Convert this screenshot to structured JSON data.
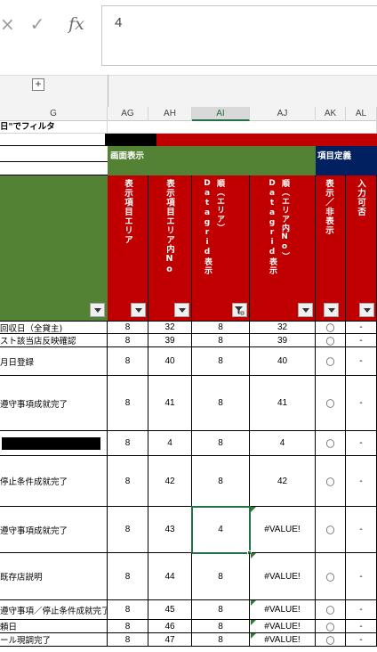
{
  "formula_bar": {
    "cancel_icon": "×",
    "enter_icon": "✓",
    "fx_icon": "fx",
    "value": "4"
  },
  "group_strip": {
    "expand_icon": "+"
  },
  "columns": [
    {
      "key": "G",
      "label": "G"
    },
    {
      "key": "AG",
      "label": "AG"
    },
    {
      "key": "AH",
      "label": "AH"
    },
    {
      "key": "AI",
      "label": "AI",
      "selected": true
    },
    {
      "key": "AJ",
      "label": "AJ"
    },
    {
      "key": "AK",
      "label": "AK"
    },
    {
      "key": "AL",
      "label": "AL"
    }
  ],
  "top_label": "日\"でフィルタ",
  "section_display": "画面表示",
  "section_item_def": "項目定義",
  "headers": {
    "ag": "表示項目エリア",
    "ah": "表示項目エリア内No",
    "ai": "順（エリア）Datagrid表示",
    "aj": "順（エリア内No）Datagrid表示",
    "ak": "表示／非表示",
    "al": "入力可否"
  },
  "rows": [
    {
      "label": "回収日（全貸主)",
      "ag": "8",
      "ah": "32",
      "ai": "8",
      "aj": "32",
      "ak": "〇",
      "al": "-"
    },
    {
      "label": "スト該当店反映確認",
      "ag": "8",
      "ah": "39",
      "ai": "8",
      "aj": "39",
      "ak": "〇",
      "al": "-"
    },
    {
      "label": "月日登録",
      "ag": "8",
      "ah": "40",
      "ai": "8",
      "aj": "40",
      "ak": "〇",
      "al": "-"
    },
    {
      "label": "遵守事項成就完了",
      "ag": "8",
      "ah": "41",
      "ai": "8",
      "aj": "41",
      "ak": "〇",
      "al": "-"
    },
    {
      "label": "",
      "ag": "8",
      "ah": "4",
      "ai": "8",
      "aj": "4",
      "ak": "〇",
      "al": "-",
      "redacted": true
    },
    {
      "label": "停止条件成就完了",
      "ag": "8",
      "ah": "42",
      "ai": "8",
      "aj": "42",
      "ak": "〇",
      "al": "-"
    },
    {
      "label": "遵守事項成就完了",
      "ag": "8",
      "ah": "43",
      "ai": "4",
      "aj": "#VALUE!",
      "ak": "〇",
      "al": "-",
      "active": true
    },
    {
      "label": "既存店説明",
      "ag": "8",
      "ah": "44",
      "ai": "8",
      "aj": "#VALUE!",
      "ak": "〇",
      "al": "-"
    },
    {
      "label": "遵守事項／停止条件成就完了",
      "ag": "8",
      "ah": "45",
      "ai": "8",
      "aj": "#VALUE!",
      "ak": "〇",
      "al": "-"
    },
    {
      "label": "頼日",
      "ag": "8",
      "ah": "46",
      "ai": "8",
      "aj": "#VALUE!",
      "ak": "〇",
      "al": "-"
    },
    {
      "label": "ール現調完了",
      "ag": "8",
      "ah": "47",
      "ai": "8",
      "aj": "#VALUE!",
      "ak": "〇",
      "al": "-"
    }
  ],
  "colors": {
    "green": "#548235",
    "red": "#c00000",
    "navy": "#002060",
    "excel_green": "#217346"
  }
}
